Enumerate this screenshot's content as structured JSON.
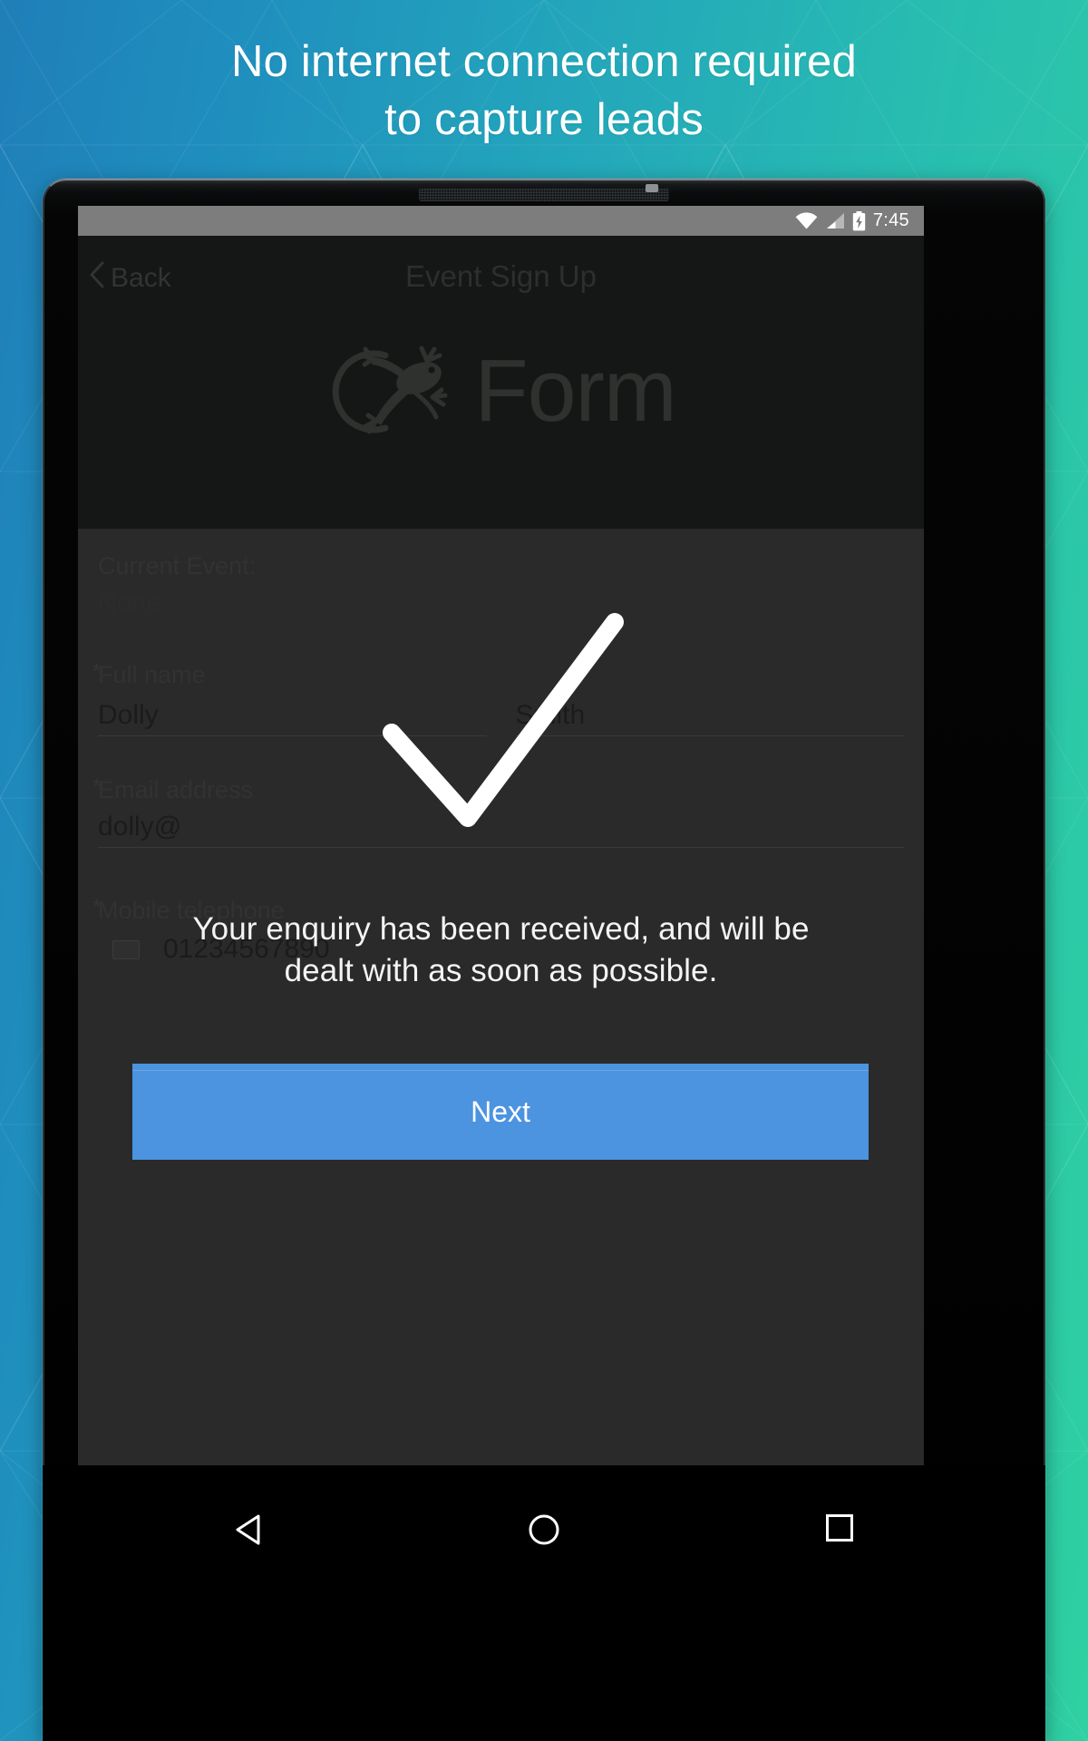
{
  "promo": {
    "headline": "No internet connection required\nto capture leads",
    "gradient_start": "#1f7fb8",
    "gradient_end": "#2fd0a2",
    "headline_color": "#ffffff"
  },
  "device": {
    "type": "android-tablet",
    "bezel_color": "#000000"
  },
  "statusbar": {
    "time": "7:45",
    "icons": [
      "wifi-icon",
      "cellular-signal-icon",
      "battery-charging-icon"
    ]
  },
  "app": {
    "back_label": "Back",
    "title": "Event Sign Up",
    "logo_word": "Form",
    "logo_icon": "gecko-icon"
  },
  "form": {
    "current_event": {
      "label": "Current Event:",
      "value": "None"
    },
    "fields": [
      {
        "label": "Full name",
        "required": true,
        "first_name": "Dolly",
        "last_name": "Smith"
      },
      {
        "label": "Email address",
        "required": true,
        "value": "dolly@"
      },
      {
        "label": "Mobile telephone",
        "required": true,
        "value": "01234567890",
        "icon": "flag-icon"
      }
    ]
  },
  "overlay": {
    "icon": "checkmark-icon",
    "message": "Your enquiry has been received, and will be\ndealt with as soon as possible.",
    "button_label": "Next",
    "button_color": "#4c93e0",
    "message_color": "#f4f4f4"
  },
  "navbar": {
    "buttons": [
      {
        "name": "back",
        "icon": "triangle-back-icon"
      },
      {
        "name": "home",
        "icon": "circle-home-icon"
      },
      {
        "name": "recents",
        "icon": "square-recents-icon"
      }
    ]
  }
}
